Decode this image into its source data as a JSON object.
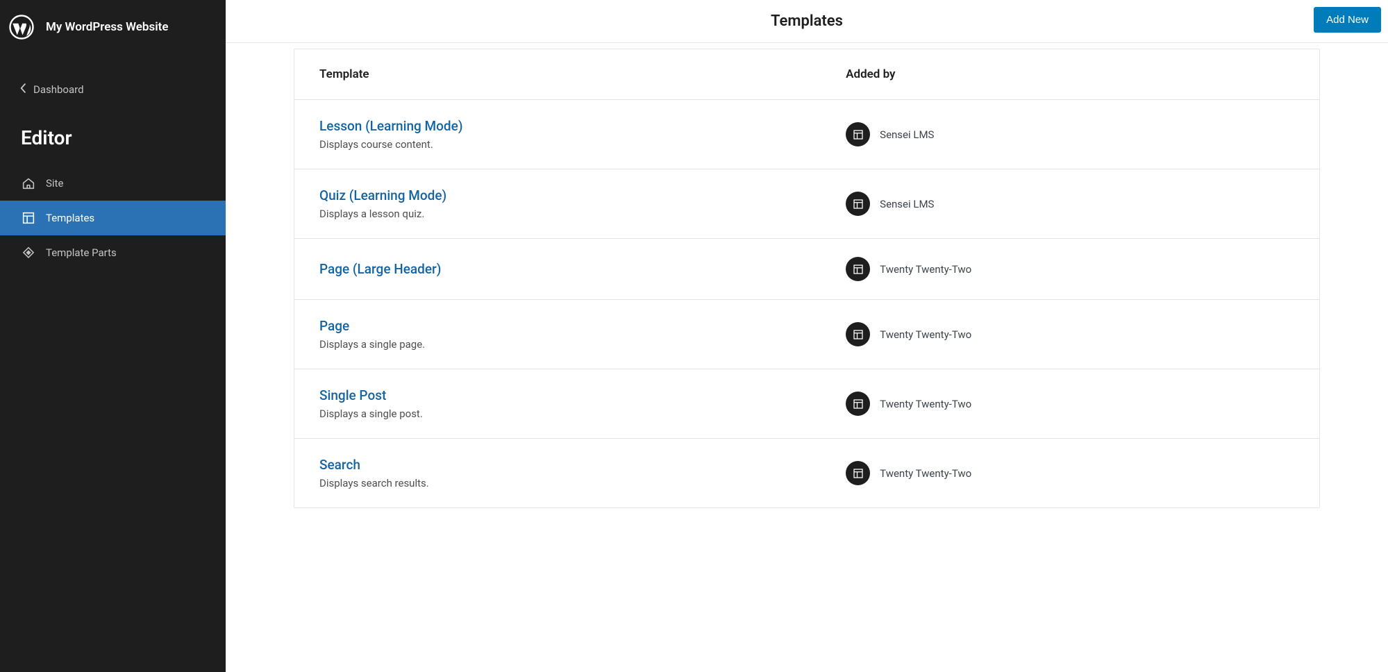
{
  "site_name": "My WordPress Website",
  "dashboard_label": "Dashboard",
  "editor_label": "Editor",
  "nav": {
    "site": "Site",
    "templates": "Templates",
    "template_parts": "Template Parts"
  },
  "page_title": "Templates",
  "add_new_label": "Add New",
  "columns": {
    "template": "Template",
    "added_by": "Added by"
  },
  "rows": [
    {
      "title": "Lesson (Learning Mode)",
      "desc": "Displays course content.",
      "added_by": "Sensei LMS"
    },
    {
      "title": "Quiz (Learning Mode)",
      "desc": "Displays a lesson quiz.",
      "added_by": "Sensei LMS"
    },
    {
      "title": "Page (Large Header)",
      "desc": "",
      "added_by": "Twenty Twenty-Two"
    },
    {
      "title": "Page",
      "desc": "Displays a single page.",
      "added_by": "Twenty Twenty-Two"
    },
    {
      "title": "Single Post",
      "desc": "Displays a single post.",
      "added_by": "Twenty Twenty-Two"
    },
    {
      "title": "Search",
      "desc": "Displays search results.",
      "added_by": "Twenty Twenty-Two"
    }
  ]
}
